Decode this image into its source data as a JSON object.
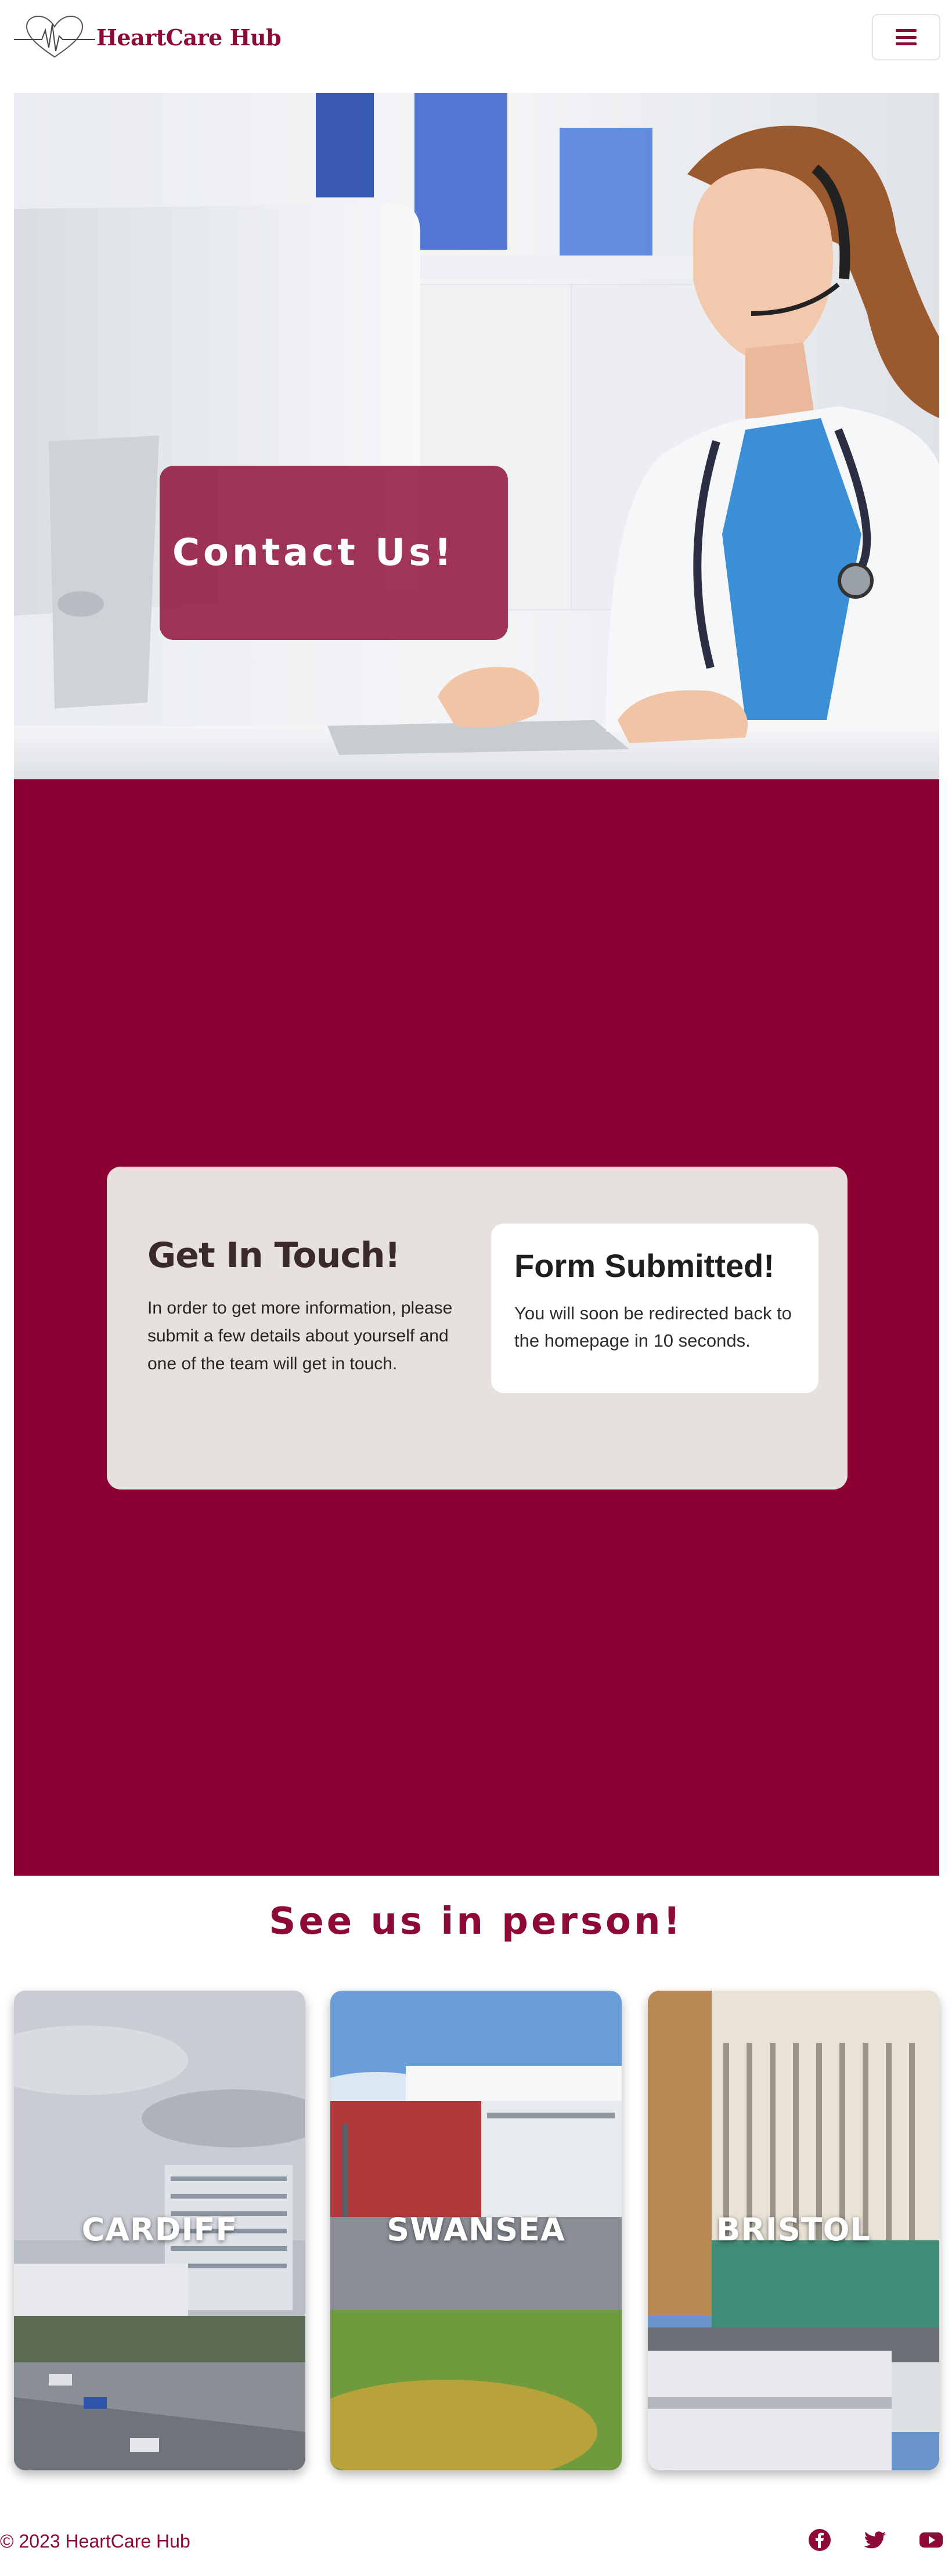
{
  "header": {
    "brand": "HeartCare Hub",
    "menu_icon": "hamburger-menu-icon"
  },
  "hero": {
    "title": "Contact Us!"
  },
  "contact": {
    "heading": "Get In Touch!",
    "description": "In order to get more information, please submit a few details about yourself and one of the team will get in touch.",
    "status_title": "Form Submitted!",
    "status_message": "You will soon be redirected back to the homepage in 10 seconds."
  },
  "locations": {
    "heading": "See us in person!",
    "items": [
      {
        "label": "CARDIFF"
      },
      {
        "label": "SWANSEA"
      },
      {
        "label": "BRISTOL"
      }
    ]
  },
  "footer": {
    "copyright": "© 2023 HeartCare Hub",
    "social": [
      "facebook-icon",
      "twitter-icon",
      "youtube-icon"
    ]
  },
  "colors": {
    "brand": "#8c0a33",
    "band": "#8c0033",
    "card": "#e6e1df"
  }
}
